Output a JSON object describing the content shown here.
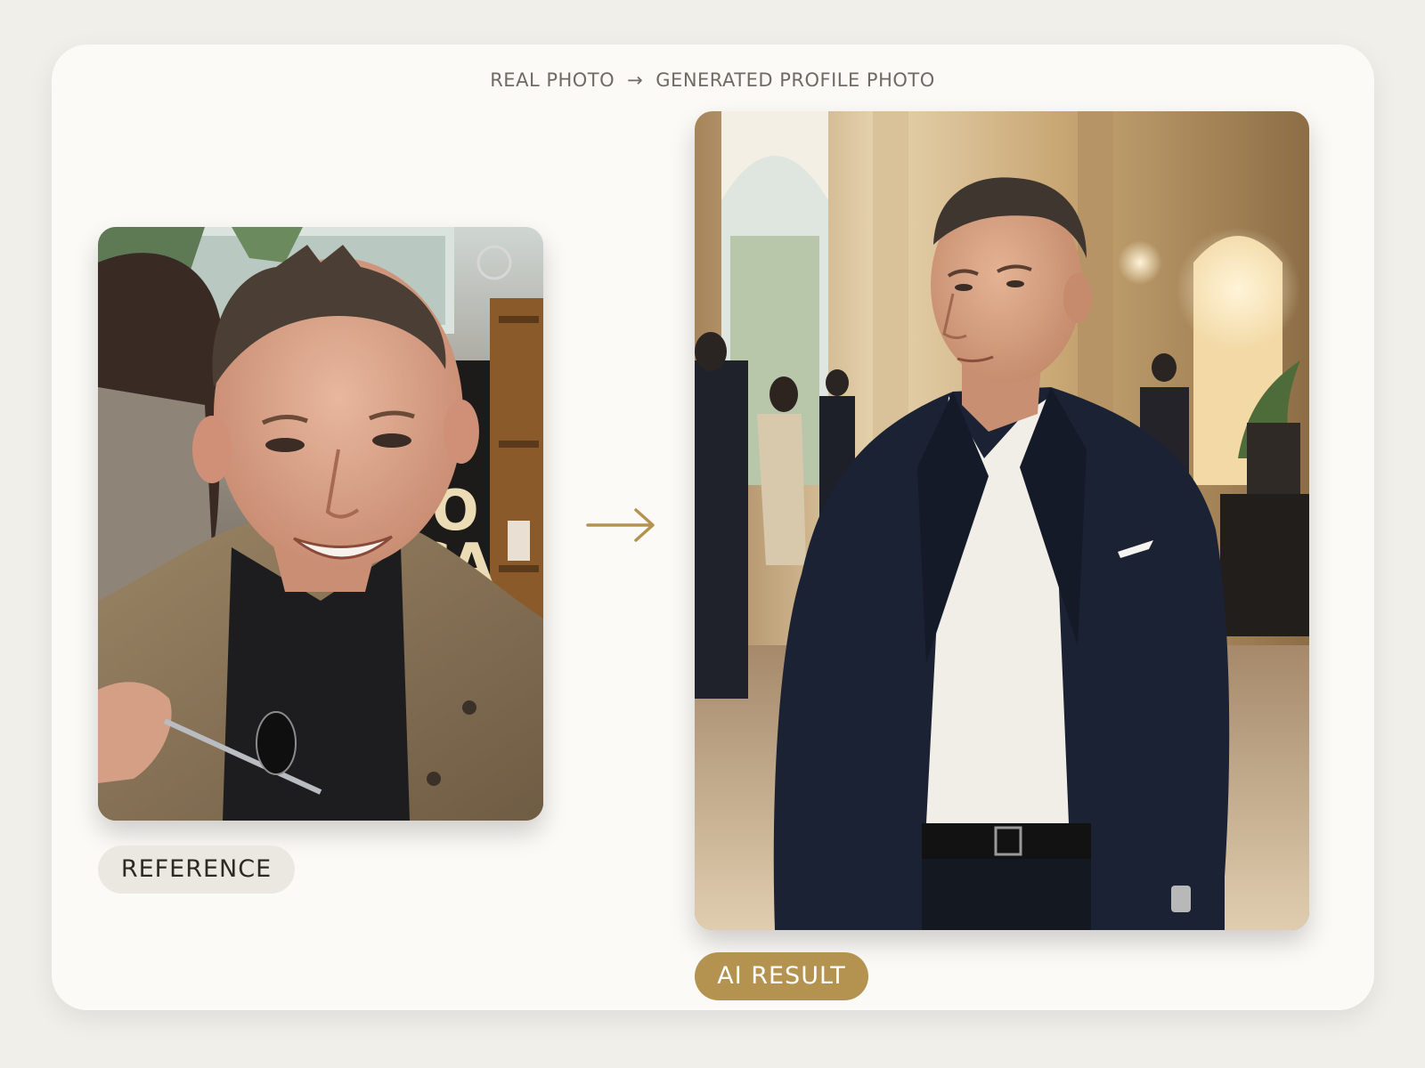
{
  "header": {
    "left_text": "REAL PHOTO",
    "separator": "→",
    "right_text": "GENERATED PROFILE PHOTO"
  },
  "reference": {
    "label": "REFERENCE",
    "sign_letters": [
      "O",
      "CA"
    ]
  },
  "result": {
    "label": "AI RESULT"
  },
  "colors": {
    "accent": "#b49250",
    "card": "#fcfaf6",
    "background": "#f1efea",
    "pill_neutral": "#ebe8e2"
  },
  "icons": {
    "middle_arrow": "arrow-right-icon"
  }
}
